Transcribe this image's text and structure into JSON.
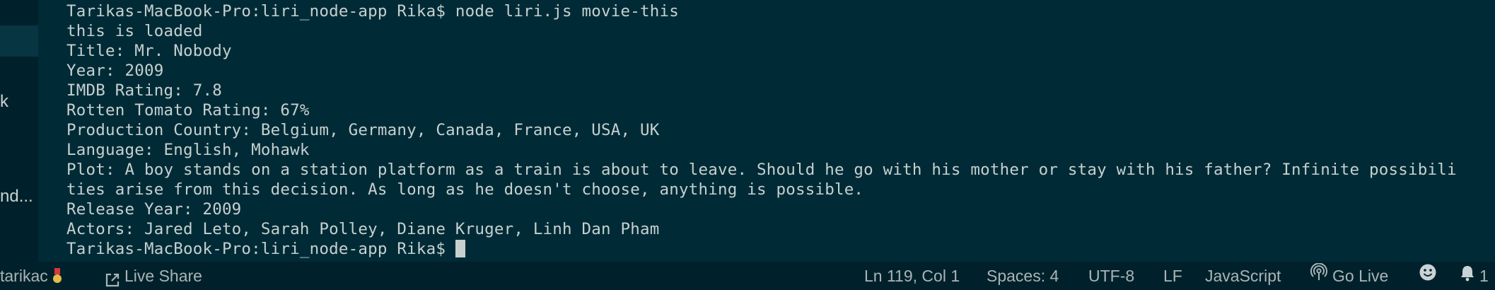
{
  "sidebar": {
    "fragments": [
      "k",
      "nd..."
    ]
  },
  "terminal": {
    "lines": [
      "Tarikas-MacBook-Pro:liri_node-app Rika$ node liri.js movie-this",
      "this is loaded",
      "Title: Mr. Nobody",
      "Year: 2009",
      "IMDB Rating: 7.8",
      "Rotten Tomato Rating: 67%",
      "Production Country: Belgium, Germany, Canada, France, USA, UK",
      "Language: English, Mohawk",
      "Plot: A boy stands on a station platform as a train is about to leave. Should he go with his mother or stay with his father? Infinite possibili",
      "ties arise from this decision. As long as he doesn't choose, anything is possible.",
      "Release Year: 2009",
      "Actors: Jared Leto, Sarah Polley, Diane Kruger, Linh Dan Pham"
    ],
    "prompt": "Tarikas-MacBook-Pro:liri_node-app Rika$ "
  },
  "statusbar": {
    "user": "tarikac",
    "live_share": "Live Share",
    "position": "Ln 119, Col 1",
    "spaces": "Spaces: 4",
    "encoding": "UTF-8",
    "eol": "LF",
    "language": "JavaScript",
    "go_live": "Go Live",
    "notifications": "1"
  },
  "icons": {
    "medal": "medal-icon",
    "share": "live-share-icon",
    "broadcast": "broadcast-icon",
    "smiley": "feedback-smiley-icon",
    "bell": "bell-icon"
  }
}
